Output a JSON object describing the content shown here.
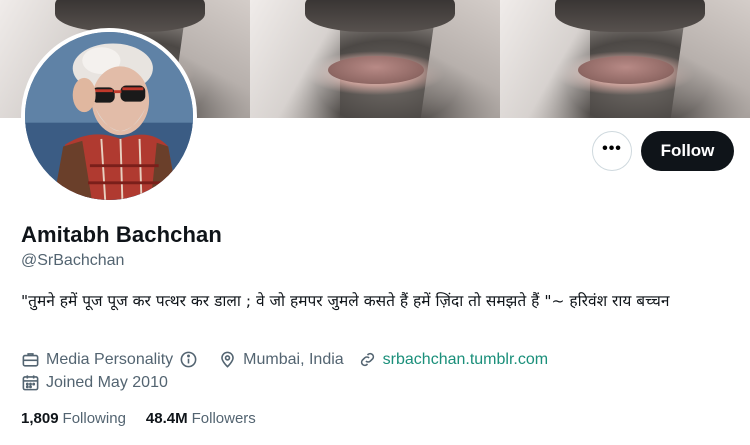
{
  "profile": {
    "name": "Amitabh Bachchan",
    "handle": "@SrBachchan",
    "bio": "\"तुमने हमें पूज पूज कर पत्थर कर डाला ; वे जो हमपर जुमले कसते हैं हमें ज़िंदा तो समझते हैं \"~  हरिवंश राय बच्चन",
    "category": "Media Personality",
    "location": "Mumbai, India",
    "website": "srbachchan.tumblr.com",
    "joined": "Joined May 2010"
  },
  "actions": {
    "more_label": "•••",
    "follow_label": "Follow"
  },
  "stats": {
    "following_count": "1,809",
    "following_label": "Following",
    "followers_count": "48.4M",
    "followers_label": "Followers"
  },
  "colors": {
    "text_primary": "#0f1419",
    "text_secondary": "#536471",
    "link": "#1a8f7a",
    "button_dark": "#0f1419"
  },
  "icons": {
    "category": "briefcase-icon",
    "info": "info-icon",
    "location": "location-pin-icon",
    "website": "link-icon",
    "joined": "calendar-icon",
    "more": "more-dots-icon"
  }
}
